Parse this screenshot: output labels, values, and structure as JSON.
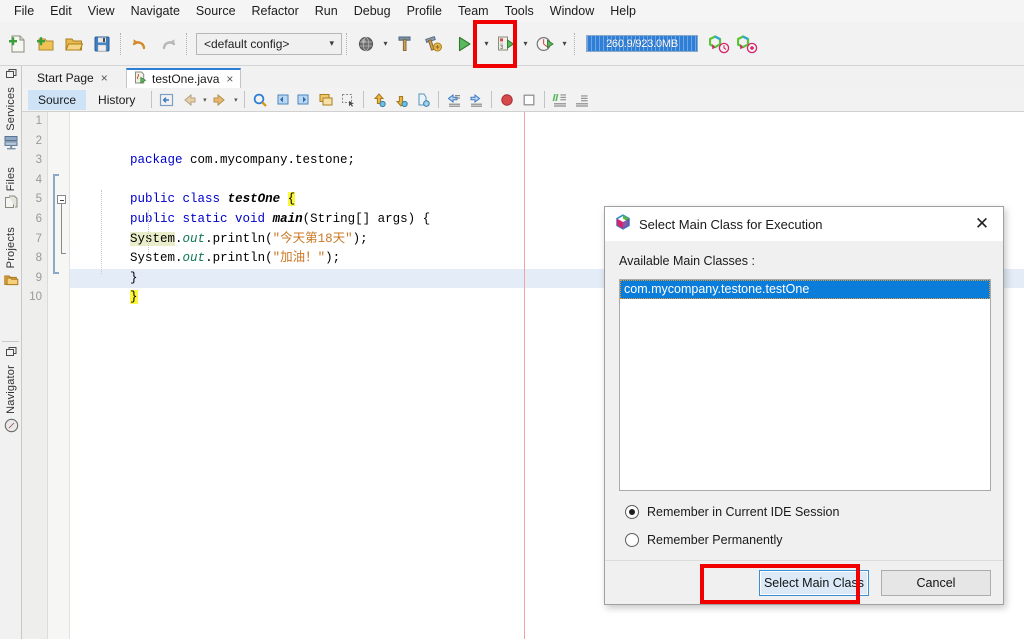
{
  "menubar": {
    "items": [
      "File",
      "Edit",
      "View",
      "Navigate",
      "Source",
      "Refactor",
      "Run",
      "Debug",
      "Profile",
      "Team",
      "Tools",
      "Window",
      "Help"
    ]
  },
  "toolbar": {
    "icons": [
      {
        "name": "new-file-icon",
        "glyph": "📄"
      },
      {
        "name": "new-project-icon",
        "glyph": "📁"
      },
      {
        "name": "open-project-icon",
        "glyph": "📂"
      },
      {
        "name": "save-all-icon",
        "glyph": "💾"
      },
      {
        "name": "undo-icon",
        "glyph": "↶"
      },
      {
        "name": "redo-icon",
        "glyph": "↷"
      }
    ],
    "config_value": "<default config>",
    "config_chevron": "▾",
    "build_icon": "build-hammer-icon",
    "clean_build_icon": "clean-build-icon",
    "globe_icon": "globe-icon",
    "run_icon": "run-project-play-icon",
    "debug_icon": "debug-project-icon",
    "profile_icon": "profile-project-icon",
    "memory": {
      "label": "260.9/923.0MB",
      "used_mb": 260.9,
      "total_mb": 923.0,
      "fill_color": "#2f7fd8"
    },
    "profiler_icons": [
      {
        "name": "profile-history-icon"
      },
      {
        "name": "profile-stop-icon"
      }
    ]
  },
  "annotations": {
    "run_button_box_color": "#f00000",
    "select_main_class_box_color": "#f00000"
  },
  "leftdock": {
    "top_group": [
      {
        "label": "Services",
        "icon": "services-icon"
      },
      {
        "label": "Files",
        "icon": "files-icon"
      },
      {
        "label": "Projects",
        "icon": "projects-icon"
      }
    ],
    "bottom_group": [
      {
        "label": "Navigator",
        "icon": "navigator-compass-icon"
      }
    ],
    "minimize_icon": "❐"
  },
  "editor_tabs": [
    {
      "label": "Start Page",
      "active": false,
      "close": "×"
    },
    {
      "label": "testOne.java",
      "active": true,
      "close": "×",
      "icon": "java-run-file-icon"
    }
  ],
  "editor_subtoolbar": {
    "view_tabs": [
      {
        "label": "Source",
        "selected": true
      },
      {
        "label": "History",
        "selected": false
      }
    ],
    "icons": [
      {
        "name": "last-edit-icon"
      },
      {
        "name": "back-icon"
      },
      {
        "name": "forward-icon"
      },
      {
        "name": "find-selection-icon"
      },
      {
        "name": "previous-bookmark-icon"
      },
      {
        "name": "next-bookmark-icon"
      },
      {
        "name": "toggle-bookmark-icon"
      },
      {
        "name": "toggle-rectangular-selection-icon"
      },
      {
        "name": "previous-error-icon"
      },
      {
        "name": "next-error-icon"
      },
      {
        "name": "inspect-icon"
      },
      {
        "name": "shift-left-icon"
      },
      {
        "name": "shift-right-icon"
      },
      {
        "name": "toggle-breakpoint-icon"
      },
      {
        "name": "stop-icon"
      },
      {
        "name": "comment-icon"
      },
      {
        "name": "uncomment-icon"
      }
    ]
  },
  "code": {
    "line_numbers": [
      "1",
      "2",
      "3",
      "4",
      "5",
      "6",
      "7",
      "8",
      "9",
      "10"
    ],
    "caret_line": 9,
    "right_margin_column_x": 502,
    "lines": [
      {
        "n": 1,
        "text": ""
      },
      {
        "n": 2,
        "text": "    package com.mycompany.testone;"
      },
      {
        "n": 3,
        "text": ""
      },
      {
        "n": 4,
        "text": "    public class testOne {"
      },
      {
        "n": 5,
        "text": "        public static void main(String[] args) {"
      },
      {
        "n": 6,
        "text": "            System.out.println(\"今天第18天\");"
      },
      {
        "n": 7,
        "text": "            System.out.println(\"加油！\");"
      },
      {
        "n": 8,
        "text": "        }"
      },
      {
        "n": 9,
        "text": "    }"
      },
      {
        "n": 10,
        "text": ""
      }
    ],
    "tokens": {
      "l2_kw": "package",
      "l2_rest": " com.mycompany.testone;",
      "l4_kw1": "public",
      "l4_kw2": "class",
      "l4_name": " testOne ",
      "l4_brace": "{",
      "l5_kw": "public static void",
      "l5_method": "main",
      "l5_rest": "(String[] args) {",
      "l6_sys": "System",
      "l6_dot1": ".",
      "l6_out": "out",
      "l6_print": ".println(",
      "l6_str": "\"今天第18天\"",
      "l6_end": ");",
      "l7_sys": "System",
      "l7_dot1": ".",
      "l7_out": "out",
      "l7_print": ".println(",
      "l7_str": "\"加油！\"",
      "l7_end": ");",
      "l8_brace": "}",
      "l9_brace": "}"
    },
    "colors": {
      "keyword": "#0000cc",
      "string": "#cc7722",
      "field": "#117755",
      "brace_highlight": "#fbf73c",
      "identifier_highlight": "#e9edc9",
      "caret_row": "#e4ecf8",
      "margin_line": "#f4a3a3"
    }
  },
  "dialog": {
    "title": "Select Main Class for Execution",
    "logo_icon": "netbeans-hexagon-icon",
    "close_icon": "✕",
    "list_label": "Available Main Classes :",
    "classes": [
      "com.mycompany.testone.testOne"
    ],
    "selected_class": "com.mycompany.testone.testOne",
    "radios": [
      {
        "label": "Remember in Current IDE Session",
        "checked": true
      },
      {
        "label": "Remember Permanently",
        "checked": false
      }
    ],
    "buttons": {
      "primary": "Select Main Class",
      "secondary": "Cancel"
    }
  }
}
